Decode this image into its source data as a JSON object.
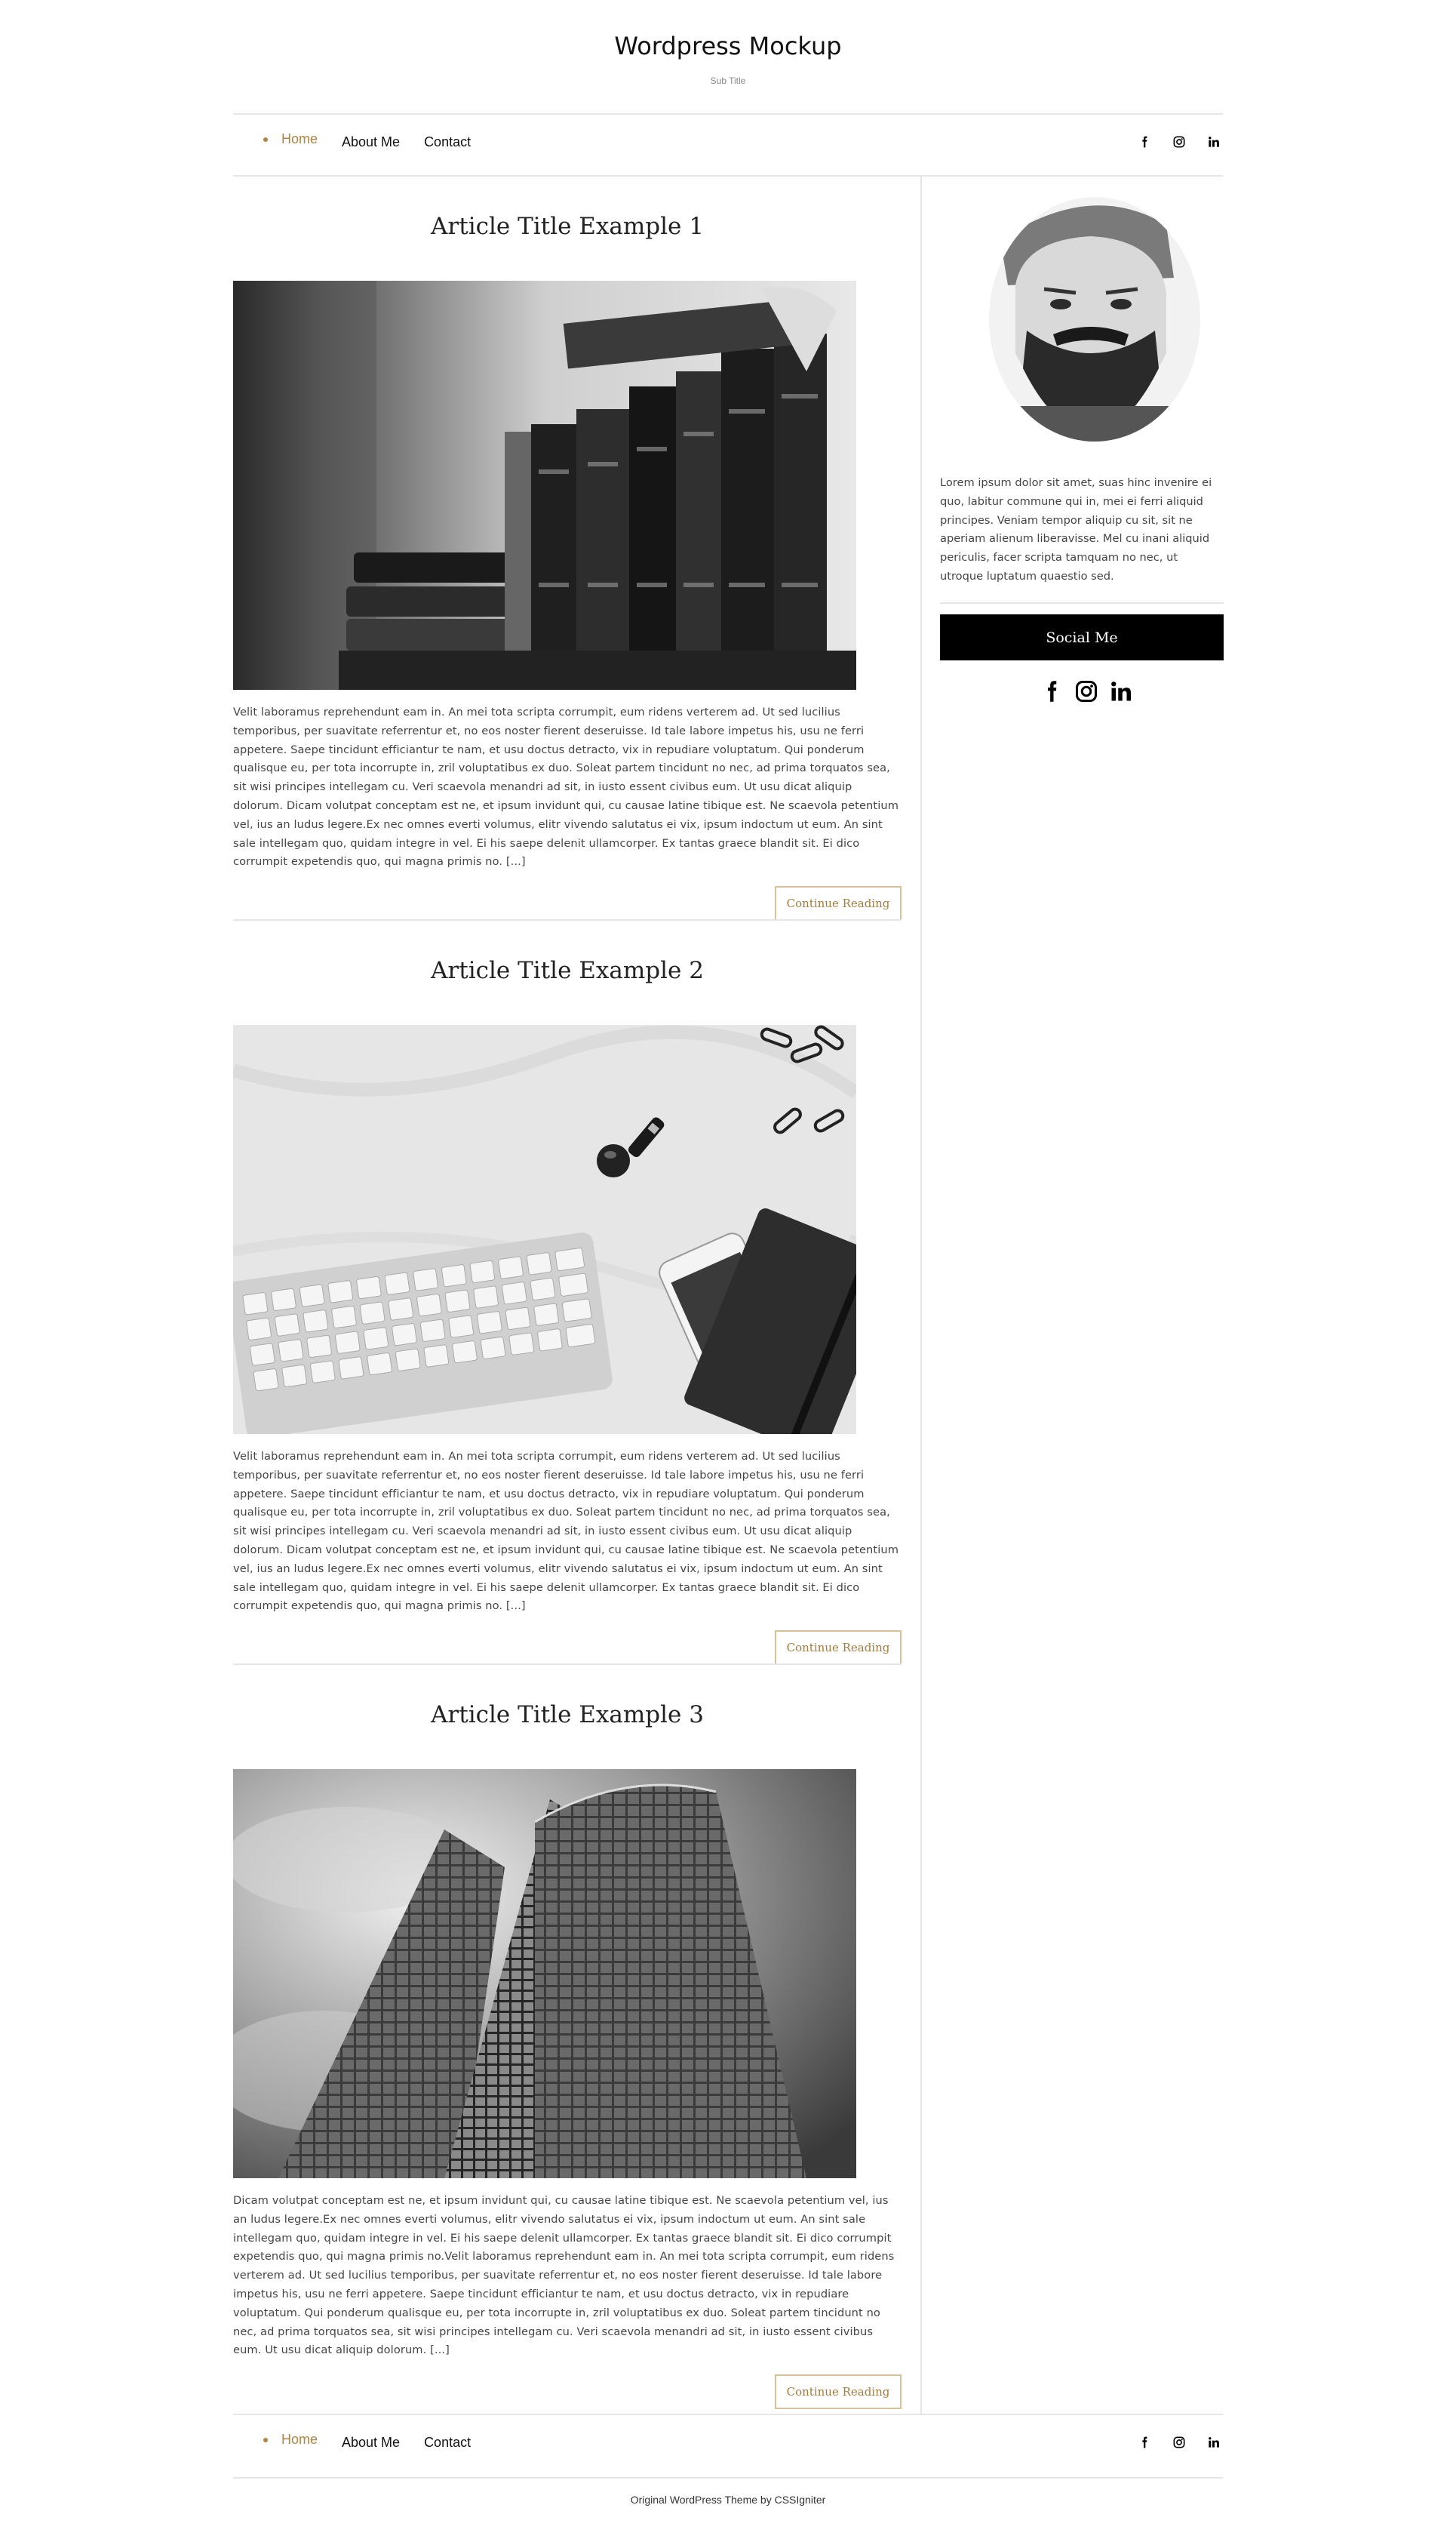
{
  "site": {
    "title": "Wordpress Mockup",
    "subtitle": "Sub Title"
  },
  "nav": {
    "items": [
      {
        "label": "Home",
        "active": true
      },
      {
        "label": "About Me",
        "active": false
      },
      {
        "label": "Contact",
        "active": false
      }
    ],
    "social_icons": [
      "facebook-icon",
      "instagram-icon",
      "linkedin-icon"
    ]
  },
  "accent_color": "#b08443",
  "articles": [
    {
      "title": "Article Title Example 1",
      "image": "books-photo",
      "excerpt": "Velit laboramus reprehendunt eam in. An mei tota scripta corrumpit, eum ridens verterem ad. Ut sed lucilius temporibus, per suavitate referrentur et, no eos noster fierent deseruisse. Id tale labore impetus his, usu ne ferri appetere. Saepe tincidunt efficiantur te nam, et usu doctus detracto, vix in repudiare voluptatum. Qui ponderum qualisque eu, per tota incorrupte in, zril voluptatibus ex duo. Soleat partem tincidunt no nec, ad prima torquatos sea, sit wisi principes intellegam cu. Veri scaevola menandri ad sit, in iusto essent civibus eum. Ut usu dicat aliquip dolorum. Dicam volutpat conceptam est ne, et ipsum invidunt qui, cu causae latine tibique est. Ne scaevola petentium vel, ius an ludus legere.Ex nec omnes everti volumus, elitr vivendo salutatus ei vix, ipsum indoctum ut eum. An sint sale intellegam quo, quidam integre in vel. Ei his saepe delenit ullamcorper. Ex tantas graece blandit sit. Ei dico corrumpit expetendis quo, qui magna primis no. [...]",
      "button": "Continue Reading"
    },
    {
      "title": "Article Title Example 2",
      "image": "desk-photo",
      "excerpt": "Velit laboramus reprehendunt eam in. An mei tota scripta corrumpit, eum ridens verterem ad. Ut sed lucilius temporibus, per suavitate referrentur et, no eos noster fierent deseruisse. Id tale labore impetus his, usu ne ferri appetere. Saepe tincidunt efficiantur te nam, et usu doctus detracto, vix in repudiare voluptatum. Qui ponderum qualisque eu, per tota incorrupte in, zril voluptatibus ex duo. Soleat partem tincidunt no nec, ad prima torquatos sea, sit wisi principes intellegam cu. Veri scaevola menandri ad sit, in iusto essent civibus eum. Ut usu dicat aliquip dolorum. Dicam volutpat conceptam est ne, et ipsum invidunt qui, cu causae latine tibique est. Ne scaevola petentium vel, ius an ludus legere.Ex nec omnes everti volumus, elitr vivendo salutatus ei vix, ipsum indoctum ut eum. An sint sale intellegam quo, quidam integre in vel. Ei his saepe delenit ullamcorper. Ex tantas graece blandit sit. Ei dico corrumpit expetendis quo, qui magna primis no. [...]",
      "button": "Continue Reading"
    },
    {
      "title": "Article Title Example 3",
      "image": "building-photo",
      "excerpt": "Dicam volutpat conceptam est ne, et ipsum invidunt qui, cu causae latine tibique est. Ne scaevola petentium vel, ius an ludus legere.Ex nec omnes everti volumus, elitr vivendo salutatus ei vix, ipsum indoctum ut eum. An sint sale intellegam quo, quidam integre in vel. Ei his saepe delenit ullamcorper. Ex tantas graece blandit sit. Ei dico corrumpit expetendis quo, qui magna primis no.Velit laboramus reprehendunt eam in. An mei tota scripta corrumpit, eum ridens verterem ad. Ut sed lucilius temporibus, per suavitate referrentur et, no eos noster fierent deseruisse. Id tale labore impetus his, usu ne ferri appetere. Saepe tincidunt efficiantur te nam, et usu doctus detracto, vix in repudiare voluptatum. Qui ponderum qualisque eu, per tota incorrupte in, zril voluptatibus ex duo. Soleat partem tincidunt no nec, ad prima torquatos sea, sit wisi principes intellegam cu. Veri scaevola menandri ad sit, in iusto essent civibus eum. Ut usu dicat aliquip dolorum. [...]",
      "button": "Continue Reading"
    }
  ],
  "sidebar": {
    "bio": "Lorem ipsum dolor sit amet, suas hinc invenire ei quo, labitur commune qui in, mei ei ferri aliquid principes. Veniam tempor aliquip cu sit, sit ne aperiam alienum liberavisse. Mel cu inani aliquid periculis, facer scripta tamquam no nec, ut utroque luptatum quaestio sed.",
    "social_button": "Social Me",
    "social_icons": [
      "facebook-icon",
      "instagram-icon",
      "linkedin-icon"
    ]
  },
  "footer": {
    "credit": "Original WordPress Theme by CSSIgniter"
  }
}
